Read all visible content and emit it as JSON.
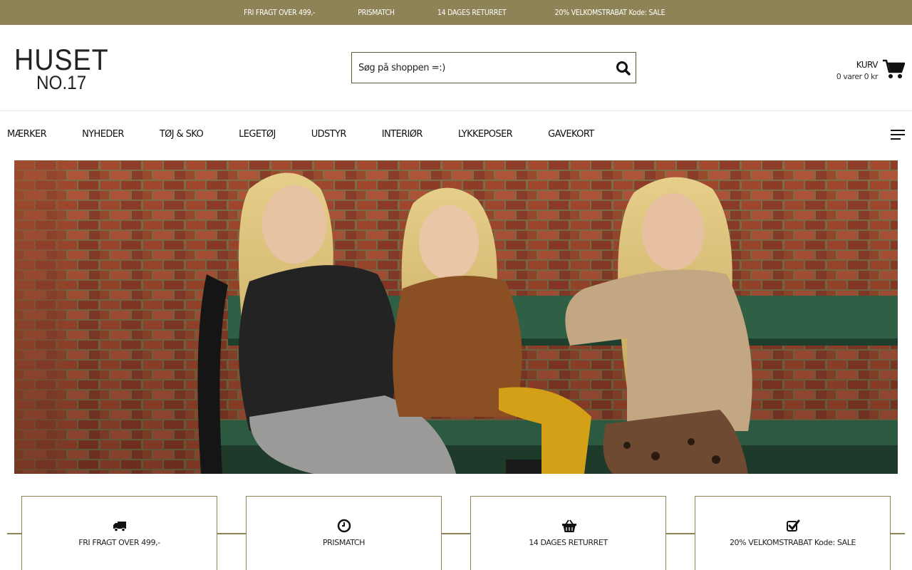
{
  "topbar": {
    "items": [
      "FRI FRAGT OVER 499,-",
      "PRISMATCH",
      "14 DAGES RETURRET",
      "20% VELKOMSTRABAT Kode: SALE"
    ],
    "background": "#8e8356"
  },
  "header": {
    "logo": {
      "line1": "HUSET",
      "line2": "NO.17"
    },
    "search": {
      "placeholder": "Søg på shoppen =:)",
      "value": "",
      "button_icon": "search-icon"
    },
    "cart": {
      "title": "KURV",
      "summary": "0 varer 0 kr",
      "icon": "cart-icon"
    }
  },
  "nav": {
    "items": [
      "MÆRKER",
      "NYHEDER",
      "TØJ & SKO",
      "LEGETØJ",
      "UDSTYR",
      "INTERIØR",
      "LYKKEPOSER",
      "GAVEKORT"
    ],
    "menu_icon": "hamburger-icon"
  },
  "usps": [
    {
      "icon": "truck-icon",
      "label": "FRI FRAGT OVER 499,-"
    },
    {
      "icon": "clock-icon",
      "label": "PRISMATCH"
    },
    {
      "icon": "basket-icon",
      "label": "14 DAGES RETURRET"
    },
    {
      "icon": "checkbox-icon",
      "label": "20% VELKOMSTRABAT Kode: SALE"
    }
  ],
  "colors": {
    "accent": "#8e8356",
    "text": "#111111"
  }
}
